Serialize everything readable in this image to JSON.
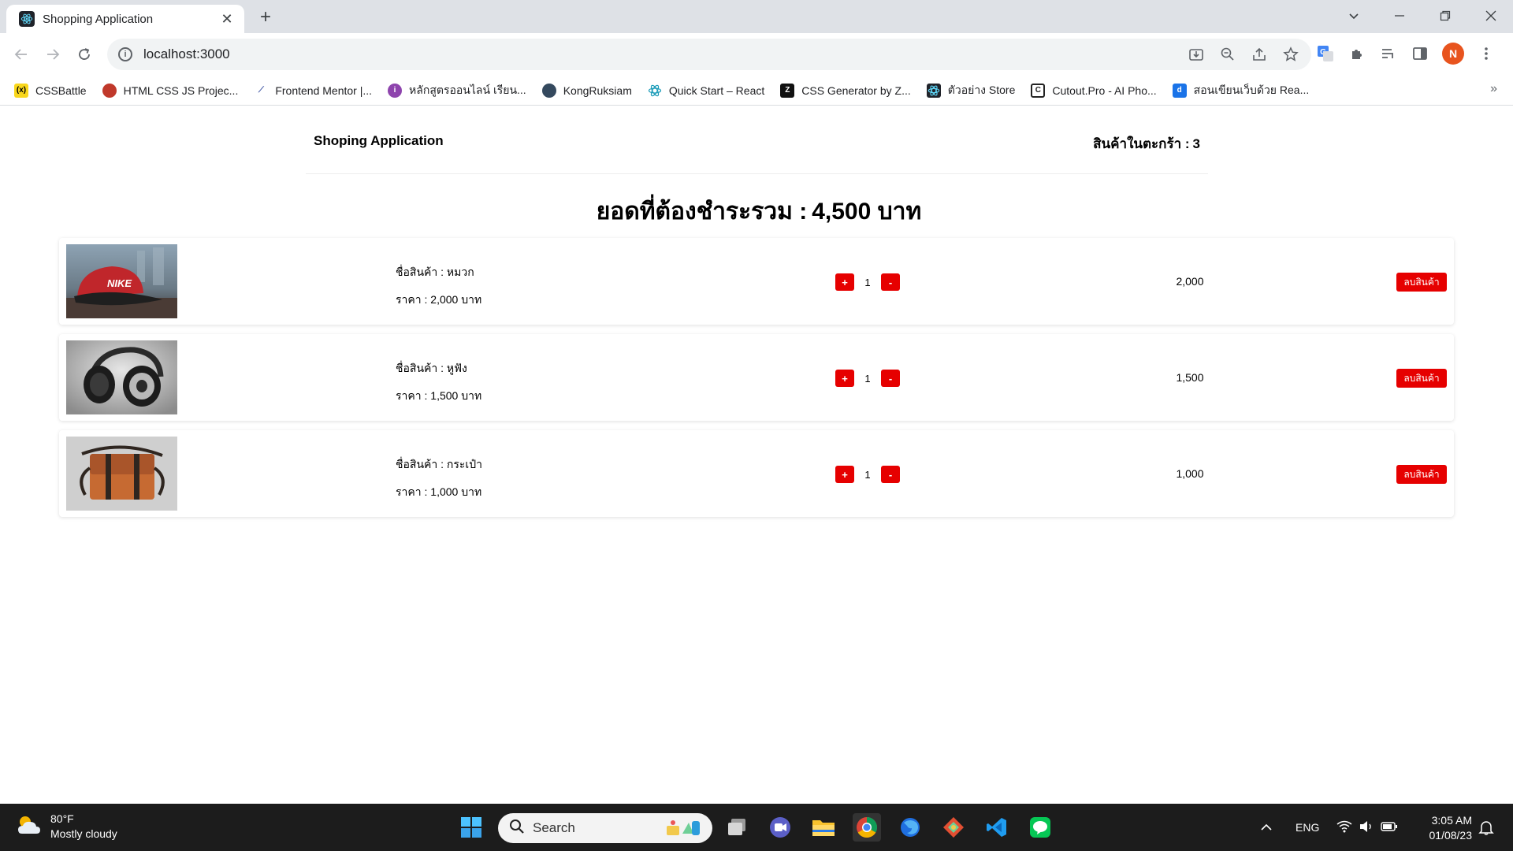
{
  "browser": {
    "tab_title": "Shopping Application",
    "url": "localhost:3000",
    "profile_initial": "N",
    "bookmarks": [
      {
        "label": "CSSBattle",
        "color": "#f9d71c"
      },
      {
        "label": "HTML CSS JS Projec...",
        "color": "#c0392b"
      },
      {
        "label": "Frontend Mentor |...",
        "color": "#3e54a3"
      },
      {
        "label": "หลักสูตรออนไลน์ เรียน...",
        "color": "#8e44ad"
      },
      {
        "label": "KongRuksiam",
        "color": "#34495e"
      },
      {
        "label": "Quick Start – React",
        "color": "#1a9bb8"
      },
      {
        "label": "CSS Generator by Z...",
        "color": "#111111"
      },
      {
        "label": "ตัวอย่าง Store",
        "color": "#20232a"
      },
      {
        "label": "Cutout.Pro - AI Pho...",
        "color": "#222222"
      },
      {
        "label": "สอนเขียนเว็บด้วย Rea...",
        "color": "#1a73e8"
      }
    ]
  },
  "app": {
    "brand": "Shoping Application",
    "cart_label": "สินค้าในตะกร้า :",
    "cart_count": "3",
    "total_label": "ยอดที่ต้องชำระรวม :",
    "total_value": "4,500 บาท"
  },
  "items": [
    {
      "name": "ชื่อสินค้า : หมวก",
      "price": "ราคา : 2,000 บาท",
      "plus": "+",
      "qty": "1",
      "minus": "-",
      "subtotal": "2,000",
      "delete": "ลบสินค้า"
    },
    {
      "name": "ชื่อสินค้า : หูฟัง",
      "price": "ราคา : 1,500 บาท",
      "plus": "+",
      "qty": "1",
      "minus": "-",
      "subtotal": "1,500",
      "delete": "ลบสินค้า"
    },
    {
      "name": "ชื่อสินค้า : กระเป๋า",
      "price": "ราคา : 1,000 บาท",
      "plus": "+",
      "qty": "1",
      "minus": "-",
      "subtotal": "1,000",
      "delete": "ลบสินค้า"
    }
  ],
  "taskbar": {
    "temperature": "80°F",
    "condition": "Mostly cloudy",
    "search_placeholder": "Search",
    "language": "ENG",
    "time": "3:05 AM",
    "date": "01/08/23"
  },
  "colors": {
    "accent_red": "#e60000",
    "tabstrip_bg": "#dee1e6",
    "taskbar_bg": "#1c1c1c"
  }
}
